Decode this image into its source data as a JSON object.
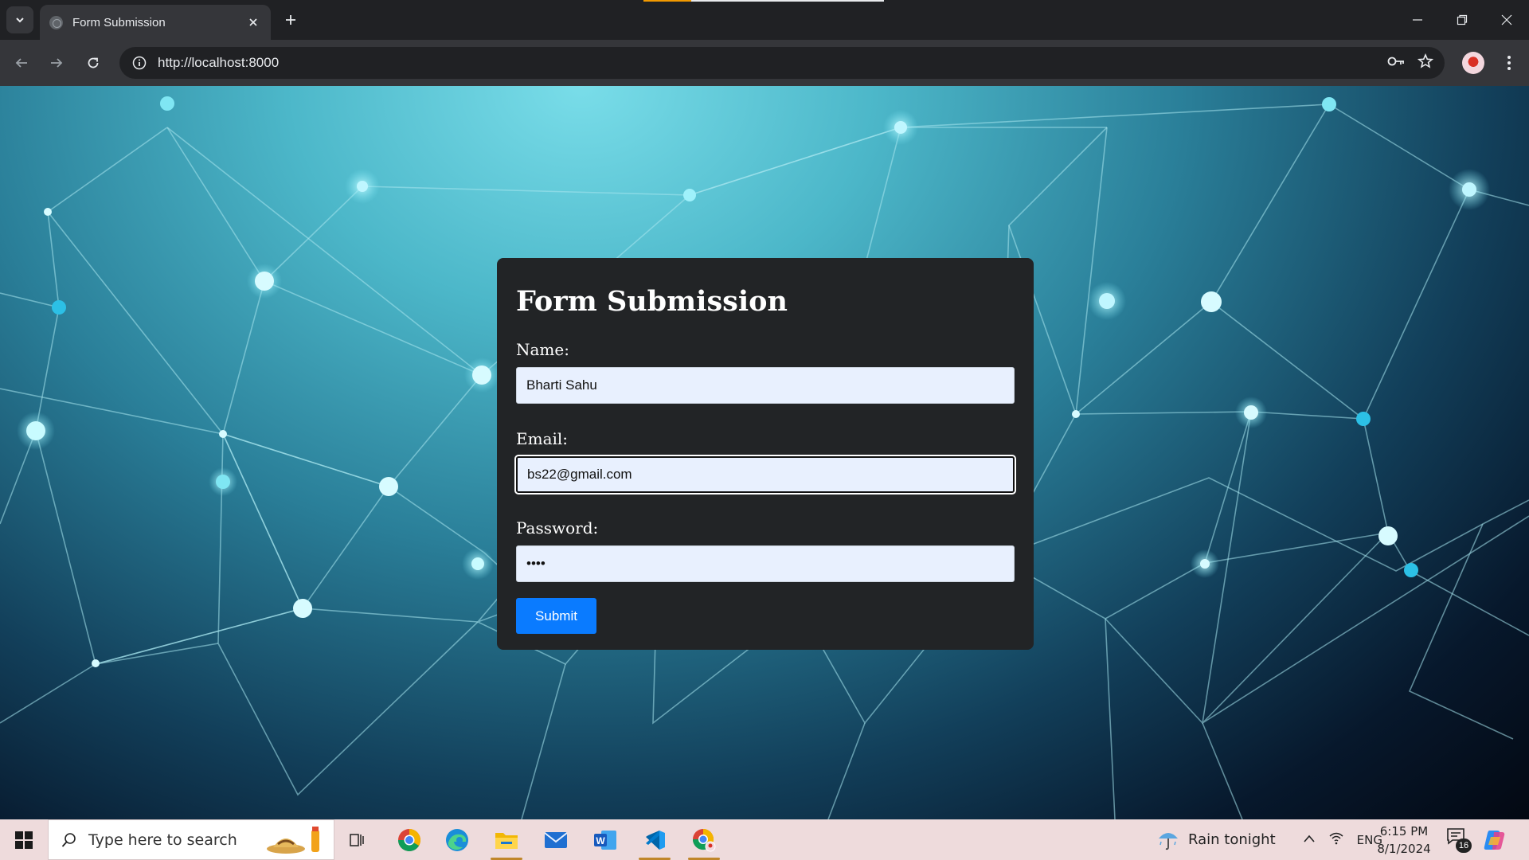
{
  "browser": {
    "tab_title": "Form Submission",
    "url": "http://localhost:8000"
  },
  "form": {
    "title": "Form Submission",
    "name_label": "Name:",
    "name_value": "Bharti Sahu",
    "email_label": "Email:",
    "email_value": "bs22@gmail.com",
    "password_label": "Password:",
    "password_value": "••••",
    "submit_label": "Submit",
    "colors": {
      "card": "#222426",
      "button": "#0a7bff",
      "field": "#e8f0fe"
    }
  },
  "taskbar": {
    "search_placeholder": "Type here to search",
    "weather": "Rain tonight",
    "language": "ENG",
    "time": "6:15 PM",
    "date": "8/1/2024",
    "notification_count": "16",
    "pinned_apps": [
      "task-view-icon",
      "chrome-icon",
      "edge-icon",
      "file-explorer-icon",
      "mail-icon",
      "word-icon",
      "vscode-icon",
      "chrome-profile-icon"
    ]
  }
}
